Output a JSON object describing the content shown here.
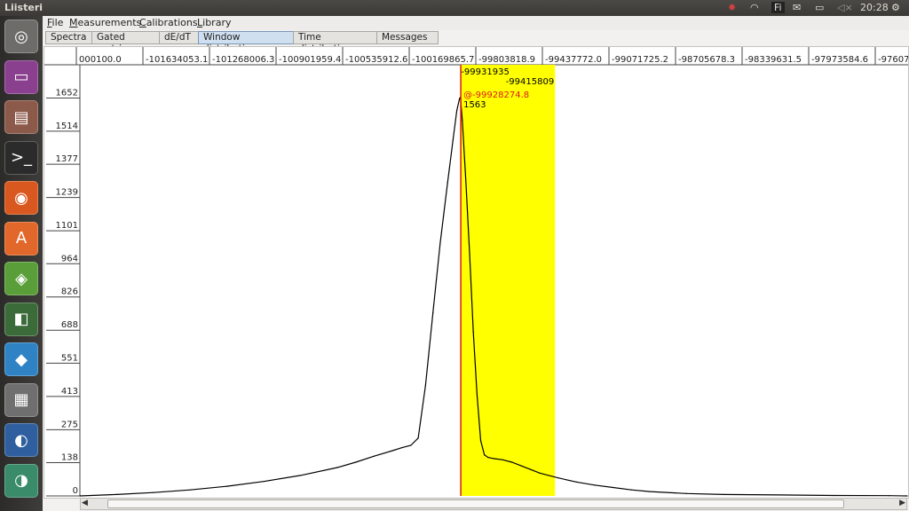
{
  "app": {
    "title": "Liisteri"
  },
  "indicators": {
    "keyboard": "Fi",
    "time": "20:28"
  },
  "launcher_items": [
    {
      "name": "ubuntu-dash-icon",
      "color": "#6e6c69"
    },
    {
      "name": "unity-lens-icon",
      "color": "#8a3f8f"
    },
    {
      "name": "file-manager-icon",
      "color": "#8c5a4a"
    },
    {
      "name": "terminal-icon",
      "color": "#2b2b2b"
    },
    {
      "name": "firefox-icon",
      "color": "#d9581f"
    },
    {
      "name": "software-center-icon",
      "color": "#e2672a"
    },
    {
      "name": "system-tool-icon",
      "color": "#5a9e3a"
    },
    {
      "name": "system-monitor-icon",
      "color": "#3c6b3a"
    },
    {
      "name": "dropbox-icon",
      "color": "#2f83c4"
    },
    {
      "name": "calculator-icon",
      "color": "#6f6f6f"
    },
    {
      "name": "thunderbird-icon",
      "color": "#2f5f9e"
    },
    {
      "name": "liisteri-app-icon",
      "color": "#3a8b6a"
    }
  ],
  "menu": {
    "file": "File",
    "measurements": "Measurements",
    "calibrations": "Calibrations",
    "library": "Library"
  },
  "tabs": [
    "Spectra",
    "Gated matrix",
    "dE/dT",
    "Window distribution",
    "Time distribution",
    "Messages"
  ],
  "active_tab": "Window distribution",
  "chart_data": {
    "type": "line",
    "x_tick_labels": [
      "000100.0",
      "-101634053.1",
      "-101268006.3",
      "-100901959.4",
      "-100535912.6",
      "-100169865.7",
      "-99803818.9",
      "-99437772.0",
      "-99071725.2",
      "-98705678.3",
      "-98339631.5",
      "-97973584.6",
      "-97607537."
    ],
    "y_tick_labels": [
      "0",
      "138",
      "275",
      "413",
      "551",
      "688",
      "826",
      "964",
      "1101",
      "1239",
      "1377",
      "1514",
      "1652"
    ],
    "y_ticks": [
      0,
      138,
      275,
      413,
      551,
      688,
      826,
      964,
      1101,
      1239,
      1377,
      1514,
      1652
    ],
    "xlim": [
      -102000100.0,
      -97500000.0
    ],
    "ylim": [
      0,
      1790
    ],
    "window": {
      "start_label": "-99931935",
      "end_label": "-99415809",
      "start": -99931935,
      "end": -99415809,
      "color": "#ffff00"
    },
    "cursor": {
      "label": "@-99928274.8",
      "x": -99928274.8,
      "value_label": "1563",
      "color": "#dd1a1a"
    },
    "series": [
      {
        "x": [
          -102000000,
          -101800000,
          -101600000,
          -101400000,
          -101200000,
          -101000000,
          -100800000,
          -100600000,
          -100500000,
          -100400000,
          -100300000,
          -100250000,
          -100200000,
          -100160000,
          -100120000,
          -100080000,
          -100040000,
          -100000000,
          -99970000,
          -99950000,
          -99935000,
          -99930000,
          -99920000,
          -99900000,
          -99880000,
          -99860000,
          -99840000,
          -99820000,
          -99800000,
          -99780000,
          -99750000,
          -99700000,
          -99650000,
          -99600000,
          -99550000,
          -99500000,
          -99450000,
          -99400000,
          -99300000,
          -99200000,
          -99100000,
          -99000000,
          -98900000,
          -98700000,
          -98500000,
          -98200000,
          -97900000,
          -97600000,
          -97500000
        ],
        "values": [
          0,
          6,
          14,
          25,
          40,
          60,
          85,
          118,
          140,
          165,
          188,
          200,
          210,
          240,
          460,
          760,
          1050,
          1300,
          1480,
          1600,
          1650,
          1655,
          1560,
          1300,
          1000,
          680,
          420,
          230,
          170,
          160,
          155,
          150,
          140,
          125,
          110,
          95,
          85,
          75,
          58,
          45,
          35,
          25,
          18,
          10,
          6,
          4,
          2,
          1,
          0
        ]
      }
    ]
  }
}
